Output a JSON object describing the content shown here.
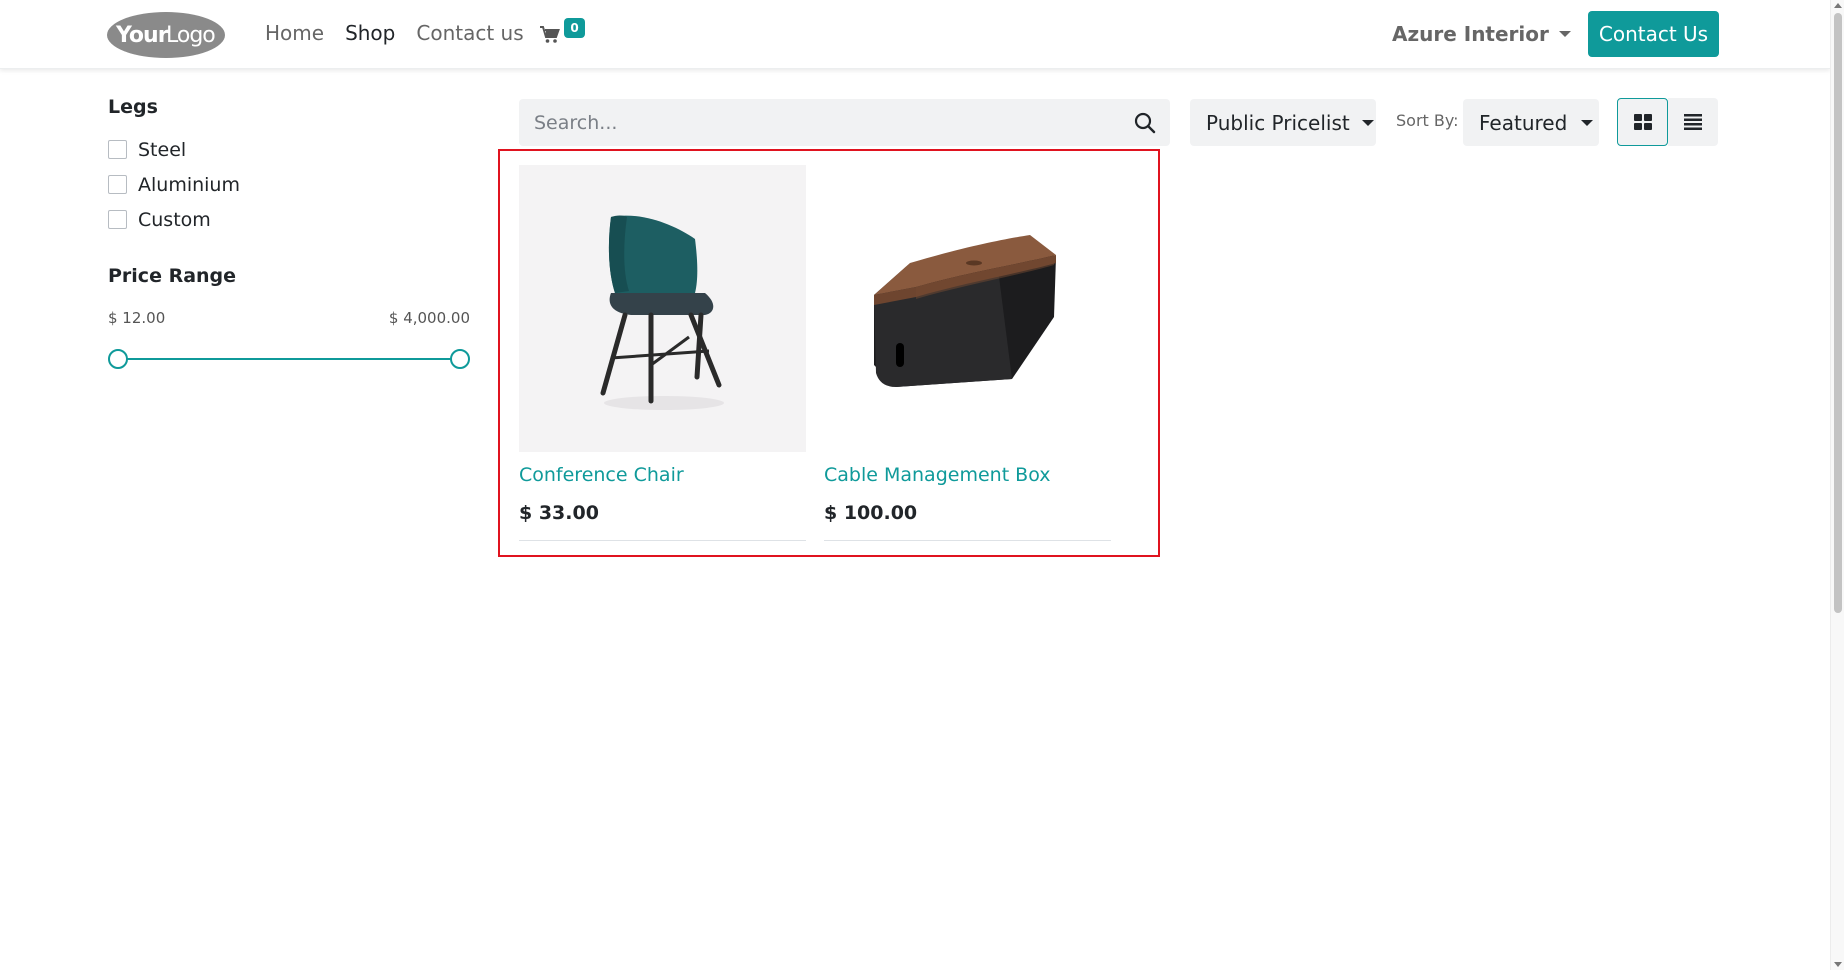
{
  "header": {
    "logo_text": "YourLogo",
    "nav": [
      "Home",
      "Shop",
      "Contact us"
    ],
    "active_nav": "Shop",
    "cart_count": "0",
    "account_name": "Azure Interior",
    "contact_button": "Contact Us"
  },
  "sidebar": {
    "legs_title": "Legs",
    "legs_options": [
      "Steel",
      "Aluminium",
      "Custom"
    ],
    "price_title": "Price Range",
    "price_min": "$ 12.00",
    "price_max": "$ 4,000.00"
  },
  "toolbar": {
    "search_placeholder": "Search...",
    "pricelist": "Public Pricelist",
    "sort_label": "Sort By:",
    "sort_value": "Featured"
  },
  "products": [
    {
      "name": "Conference Chair",
      "price": "$ 33.00"
    },
    {
      "name": "Cable Management Box",
      "price": "$ 100.00"
    }
  ],
  "colors": {
    "accent": "#0f9a9a",
    "highlight": "#e0131f"
  }
}
